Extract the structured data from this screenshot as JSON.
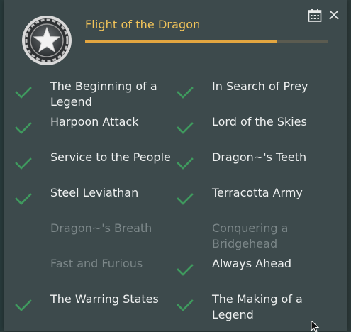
{
  "header": {
    "title": "Flight of the Dragon",
    "progress": 0.79,
    "emblem_icon": "star-badge-icon",
    "calendar_icon": "calendar-icon",
    "close_icon": "close-icon"
  },
  "colors": {
    "background": "#3d4a4c",
    "title": "#f2c45a",
    "progress": "#e3a640",
    "check": "#3f9a5e",
    "completed_text": "#eef0f0",
    "locked_text": "#7c8789"
  },
  "achievements": {
    "left": [
      {
        "label": "The Beginning of a Legend",
        "completed": true
      },
      {
        "label": "Harpoon Attack",
        "completed": true
      },
      {
        "label": "Service to the People",
        "completed": true
      },
      {
        "label": "Steel Leviathan",
        "completed": true
      },
      {
        "label": "Dragon~'s Breath",
        "completed": false
      },
      {
        "label": "Fast and Furious",
        "completed": false
      },
      {
        "label": "The Warring States",
        "completed": true
      }
    ],
    "right": [
      {
        "label": "In Search of Prey",
        "completed": true
      },
      {
        "label": "Lord of the Skies",
        "completed": true
      },
      {
        "label": "Dragon~'s Teeth",
        "completed": true
      },
      {
        "label": "Terracotta Army",
        "completed": true
      },
      {
        "label": "Conquering a Bridgehead",
        "completed": false
      },
      {
        "label": "Always Ahead",
        "completed": true
      },
      {
        "label": "The Making of a Legend",
        "completed": true
      }
    ]
  }
}
